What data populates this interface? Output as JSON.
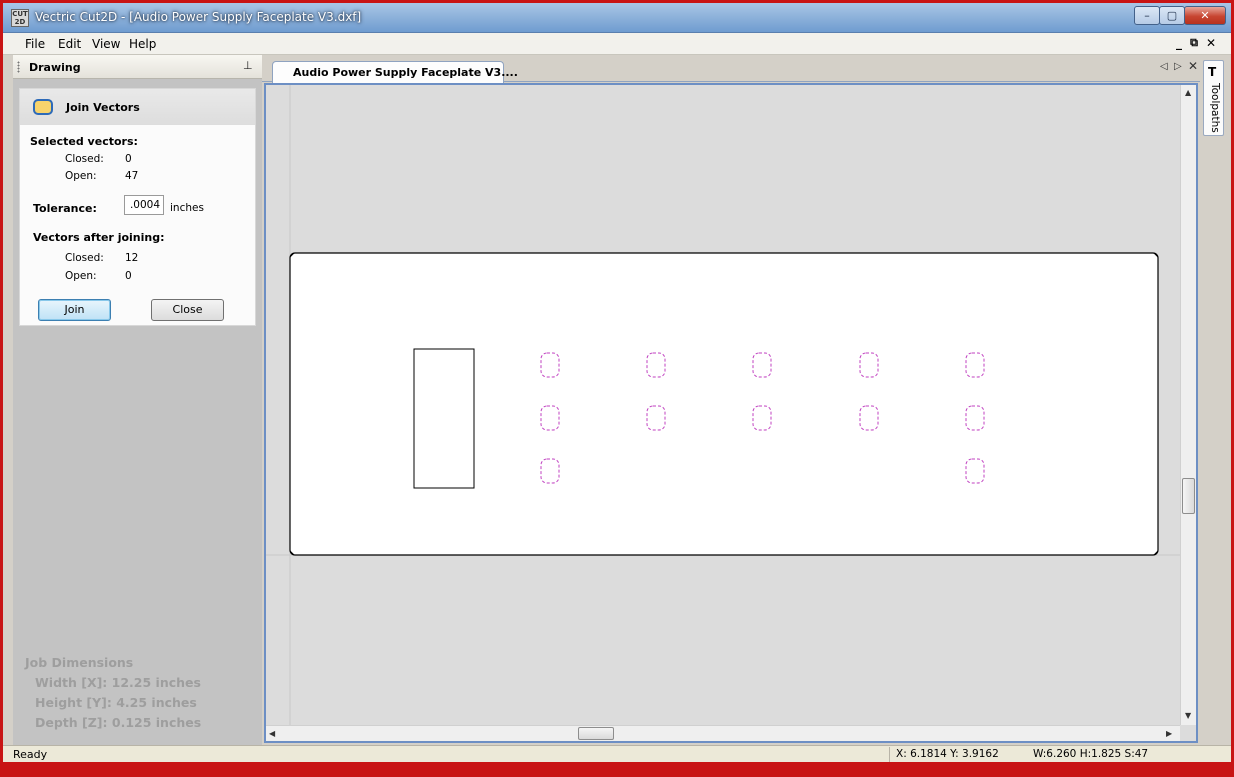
{
  "window": {
    "title": "Vectric Cut2D - [Audio Power Supply Faceplate V3.dxf]",
    "icon_text": "CUT 2D",
    "minimize": "–",
    "maximize": "▢",
    "close": "✕"
  },
  "menu": {
    "file": "File",
    "edit": "Edit",
    "view": "View",
    "help": "Help",
    "mdi_min": "_",
    "mdi_restore": "⧉",
    "mdi_close": "✕"
  },
  "panel": {
    "title": "Drawing",
    "pin": "⊥",
    "join": {
      "title": "Join Vectors",
      "selected_label": "Selected vectors:",
      "closed_label": "Closed:",
      "open_label": "Open:",
      "selected_closed": "0",
      "selected_open": "47",
      "tolerance_label": "Tolerance:",
      "tolerance_value": ".0004",
      "tolerance_unit": "inches",
      "after_label": "Vectors after joining:",
      "after_closed": "12",
      "after_open": "0",
      "join_button": "Join",
      "close_button": "Close"
    },
    "job": {
      "heading": "Job Dimensions",
      "width": "Width  [X]: 12.25 inches",
      "height": "Height [Y]: 4.25 inches",
      "depth": "Depth  [Z]: 0.125 inches"
    }
  },
  "doc": {
    "tab_label": "Audio Power Supply Faceplate V3....",
    "tab_left": "◁",
    "tab_right": "▷",
    "tab_close": "✕"
  },
  "dock": {
    "toolpaths_label": "Toolpaths",
    "toolpaths_icon": "T"
  },
  "status": {
    "ready": "Ready",
    "coords": "X: 6.1814 Y:  3.9162",
    "dims": "W:6.260  H:1.825  S:47"
  },
  "colors": {
    "vector_outline": "#000000",
    "selected_vectors": "#c040c0",
    "canvas_bg": "#dcdcdc",
    "job_bg": "#ffffff"
  },
  "icons": {
    "join": "join-vectors-icon",
    "pin": "pin-icon",
    "toolpaths": "toolpaths-icon"
  }
}
